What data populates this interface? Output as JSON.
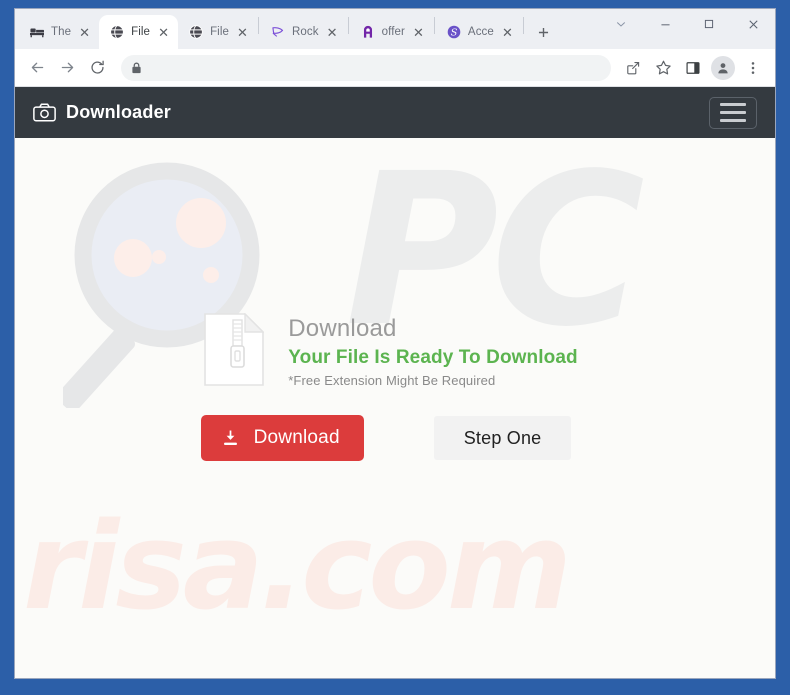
{
  "window": {
    "controls": {
      "tab_search": "tab-search",
      "minimize": "–",
      "maximize": "☐",
      "close": "✕"
    }
  },
  "tabs": [
    {
      "title": "The ",
      "favicon": "bed-icon",
      "active": false,
      "close": "✕"
    },
    {
      "title": "File ",
      "favicon": "globe-icon",
      "active": true,
      "close": "✕"
    },
    {
      "title": "File ",
      "favicon": "globe-icon",
      "active": false,
      "close": "✕"
    },
    {
      "title": "Rock",
      "favicon": "cursor-icon",
      "active": false,
      "close": "✕"
    },
    {
      "title": "offer",
      "favicon": "letter-a-icon",
      "active": false,
      "close": "✕"
    },
    {
      "title": "Acce",
      "favicon": "dollar-icon",
      "active": false,
      "close": "✕"
    }
  ],
  "newtab": {
    "label": "+"
  },
  "toolbar": {
    "back": "←",
    "forward": "→",
    "reload": "reload-icon",
    "lock": "lock-icon",
    "url": "",
    "url_placeholder": "",
    "share": "share-icon",
    "bookmark": "star-icon",
    "side_panel": "side-panel-icon",
    "profile": "profile-avatar-icon",
    "menu": "three-dot-menu-icon"
  },
  "page": {
    "header": {
      "logo": "camera-icon",
      "brand": "Downloader",
      "menu_toggle": "hamburger-menu"
    },
    "watermarks": {
      "pc": "PC",
      "risa": "risa.com"
    },
    "download": {
      "file_icon": "zip-file-icon",
      "title": "Download",
      "ready": "Your File Is Ready To Download",
      "note": "*Free Extension Might Be Required",
      "download_button": "Download",
      "download_button_icon": "download-icon",
      "step_button": "Step One"
    }
  },
  "colors": {
    "window_frame": "#2c5fa8",
    "site_header": "#343a40",
    "accent_green": "#5cb450",
    "download_red": "#dc3c3c",
    "step_grey": "#f2f2f2",
    "watermark_grey": "#eceded",
    "watermark_pink": "#fbece7"
  }
}
